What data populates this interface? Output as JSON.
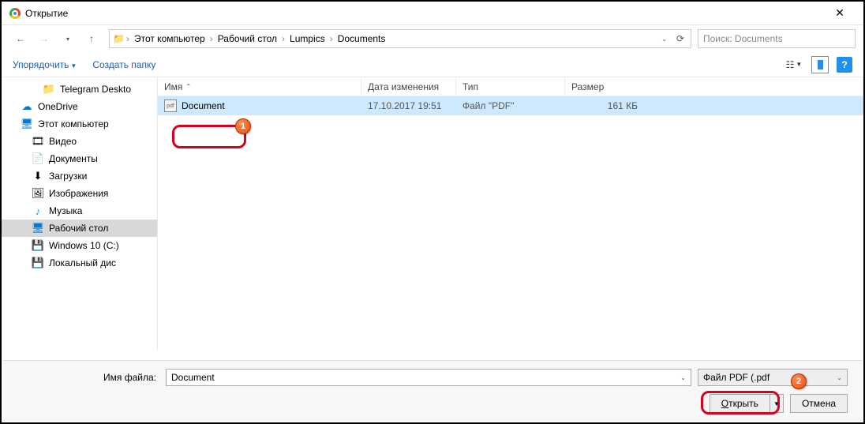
{
  "title": "Открытие",
  "nav": {
    "up_sep": "›"
  },
  "breadcrumbs": [
    "Этот компьютер",
    "Рабочий стол",
    "Lumpics",
    "Documents"
  ],
  "search": {
    "placeholder": "Поиск: Documents"
  },
  "toolbar": {
    "organize": "Упорядочить",
    "new_folder": "Создать папку"
  },
  "columns": {
    "name": "Имя",
    "date": "Дата изменения",
    "type": "Тип",
    "size": "Размер"
  },
  "tree": [
    {
      "label": "Telegram Deskto",
      "icon": "📁",
      "level": 3
    },
    {
      "label": "OneDrive",
      "icon": "☁",
      "level": 1,
      "color": "#0078d4"
    },
    {
      "label": "Этот компьютер",
      "icon": "🖥",
      "level": 1,
      "color": "#0078d4"
    },
    {
      "label": "Видео",
      "icon": "🎞",
      "level": 2
    },
    {
      "label": "Документы",
      "icon": "📄",
      "level": 2
    },
    {
      "label": "Загрузки",
      "icon": "⬇",
      "level": 2
    },
    {
      "label": "Изображения",
      "icon": "🖼",
      "level": 2
    },
    {
      "label": "Музыка",
      "icon": "♪",
      "level": 2,
      "color": "#1a90d8"
    },
    {
      "label": "Рабочий стол",
      "icon": "🖥",
      "level": 2,
      "selected": true,
      "color": "#0078d4"
    },
    {
      "label": "Windows 10 (C:)",
      "icon": "💾",
      "level": 2
    },
    {
      "label": "Локальный дис",
      "icon": "💾",
      "level": 2
    }
  ],
  "files": [
    {
      "name": "Document",
      "date": "17.10.2017 19:51",
      "type": "Файл \"PDF\"",
      "size": "161 КБ"
    }
  ],
  "footer": {
    "filename_label": "Имя файла:",
    "filename_value": "Document",
    "filter": "Файл PDF (.pdf",
    "open": "Открыть",
    "open_key": "О",
    "cancel": "Отмена"
  },
  "annotations": {
    "1": "1",
    "2": "2"
  }
}
